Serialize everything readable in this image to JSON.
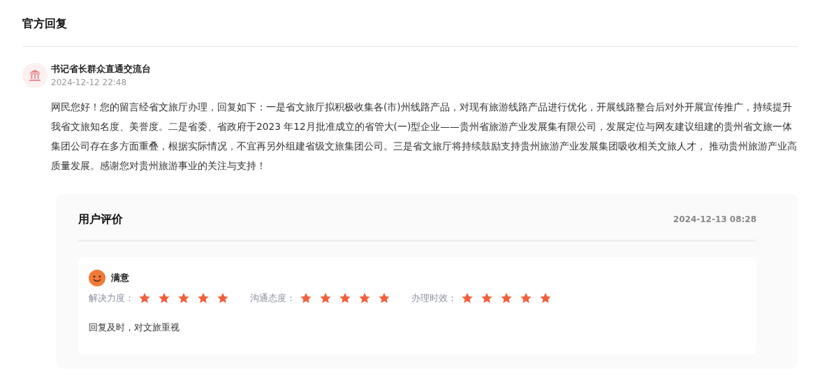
{
  "section_title": "官方回复",
  "reply": {
    "author": "书记省长群众直通交流台",
    "time": "2024-12-12 22:48",
    "body": "网民您好！您的留言经省文旅厅办理，回复如下：一是省文旅厅拟积极收集各(市)州线路产品，对现有旅游线路产品进行优化，开展线路整合后对外开展宣传推广，持续提升我省文旅知名度、美誉度。二是省委、省政府于2023 年12月批准成立的省管大(一)型企业——贵州省旅游产业发展集有限公司，发展定位与网友建议组建的贵州省文旅一体集团公司存在多方面重叠，根据实际情况，不宜再另外组建省级文旅集团公司。三是省文旅厅将持续鼓励支持贵州旅游产业发展集团吸收相关文旅人才， 推动贵州旅游产业高质量发展。感谢您对贵州旅游事业的关注与支持！"
  },
  "evaluation": {
    "title": "用户评价",
    "time": "2024-12-13 08:28",
    "verdict": "满意",
    "ratings": [
      {
        "label": "解决力度：",
        "stars": 5
      },
      {
        "label": "沟通态度：",
        "stars": 5
      },
      {
        "label": "办理时效：",
        "stars": 5
      }
    ],
    "comment": "回复及时，对文旅重视"
  }
}
